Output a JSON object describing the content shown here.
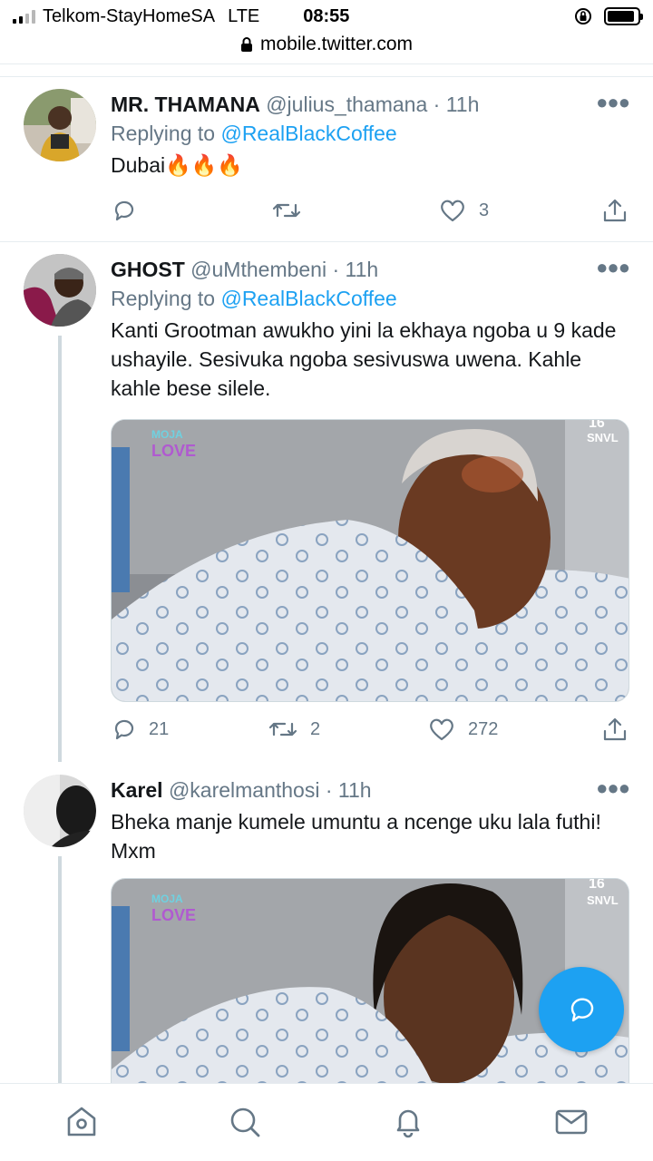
{
  "status_bar": {
    "carrier": "Telkom-StayHomeSA",
    "network": "LTE",
    "time": "08:55",
    "battery_level": 0.9
  },
  "browser": {
    "url": "mobile.twitter.com"
  },
  "colors": {
    "accent": "#1da1f2",
    "secondary_text": "#657786",
    "primary_text": "#14171a",
    "divider": "#e6ecf0"
  },
  "tweets": [
    {
      "display_name": "MR. THAMANA",
      "handle": "@julius_thamana",
      "separator": "·",
      "time": "11h",
      "replying_prefix": "Replying to",
      "replying_to": "@RealBlackCoffee",
      "text": "Dubai",
      "emoji": "🔥🔥🔥",
      "reply_count": "",
      "retweet_count": "",
      "like_count": "3"
    },
    {
      "display_name": "GHOST",
      "handle": "@uMthembeni",
      "separator": "·",
      "time": "11h",
      "replying_prefix": "Replying to",
      "replying_to": "@RealBlackCoffee",
      "text": "Kanti Grootman awukho yini la ekhaya ngoba u 9 kade ushayile. Sesivuka ngoba sesivuswa uwena. Kahle kahle bese silele.",
      "media": {
        "logo_line1": "MOJA",
        "logo_line2": "LOVE",
        "corner_tag_top": "16",
        "corner_tag_bottom": "SNVL"
      },
      "reply_count": "21",
      "retweet_count": "2",
      "like_count": "272"
    },
    {
      "display_name": "Karel",
      "handle": "@karelmanthosi",
      "separator": "·",
      "time": "11h",
      "text": "Bheka manje kumele umuntu a ncenge uku lala futhi! Mxm",
      "media": {
        "logo_line1": "MOJA",
        "logo_line2": "LOVE",
        "corner_tag_top": "16",
        "corner_tag_bottom": "SNVL"
      }
    }
  ],
  "icons": {
    "more": "more-options-icon",
    "reply": "reply-icon",
    "retweet": "retweet-icon",
    "like": "heart-icon",
    "share": "share-icon",
    "compose": "compose-reply-icon",
    "nav": [
      "home-icon",
      "search-icon",
      "notifications-icon",
      "messages-icon"
    ]
  }
}
